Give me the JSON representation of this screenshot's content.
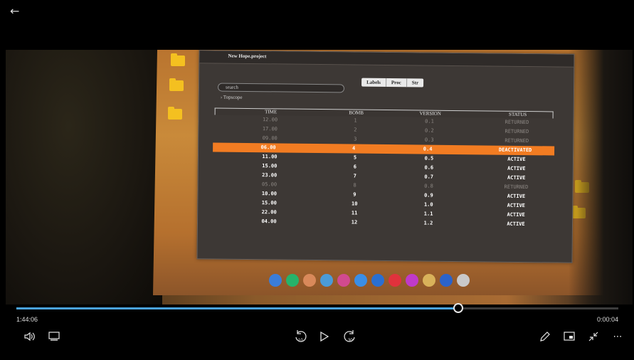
{
  "player": {
    "back_icon": "back-arrow-icon",
    "time_elapsed": "1:44:06",
    "time_remaining": "0:00:04",
    "progress_fraction": 0.734,
    "controls": {
      "volume_icon": "speaker-icon",
      "captions_icon": "captions-icon",
      "skip_back_label": "10",
      "play_icon": "play-icon",
      "skip_forward_label": "30",
      "edit_icon": "pencil-icon",
      "miniplayer_icon": "miniplayer-icon",
      "exit_fullscreen_icon": "exit-fullscreen-icon",
      "more_icon": "more-icon"
    },
    "accent_color": "#4aa3df"
  },
  "video": {
    "app_title": "New Hope.project",
    "search_placeholder": "search",
    "tree_item": "Topscope",
    "tabs": [
      "Labels",
      "Proc",
      "Str"
    ],
    "columns": [
      "TIME",
      "BOMB",
      "VERSION",
      "STATUS"
    ],
    "rows": [
      {
        "time": "12.00",
        "bomb": "1",
        "version": "0.1",
        "status": "RETURNED",
        "style": "dim"
      },
      {
        "time": "17.00",
        "bomb": "2",
        "version": "0.2",
        "status": "RETURNED",
        "style": "dim"
      },
      {
        "time": "09.00",
        "bomb": "3",
        "version": "0.3",
        "status": "RETURNED",
        "style": "dim"
      },
      {
        "time": "06.00",
        "bomb": "4",
        "version": "0.4",
        "status": "DEACTIVATED",
        "style": "selected"
      },
      {
        "time": "11.00",
        "bomb": "5",
        "version": "0.5",
        "status": "ACTIVE",
        "style": "bright"
      },
      {
        "time": "15.00",
        "bomb": "6",
        "version": "0.6",
        "status": "ACTIVE",
        "style": "bright"
      },
      {
        "time": "23.00",
        "bomb": "7",
        "version": "0.7",
        "status": "ACTIVE",
        "style": "bright"
      },
      {
        "time": "05.00",
        "bomb": "8",
        "version": "0.8",
        "status": "RETURNED",
        "style": "dim"
      },
      {
        "time": "10.00",
        "bomb": "9",
        "version": "0.9",
        "status": "ACTIVE",
        "style": "bright"
      },
      {
        "time": "15.00",
        "bomb": "10",
        "version": "1.0",
        "status": "ACTIVE",
        "style": "bright"
      },
      {
        "time": "22.00",
        "bomb": "11",
        "version": "1.1",
        "status": "ACTIVE",
        "style": "bright"
      },
      {
        "time": "04.00",
        "bomb": "12",
        "version": "1.2",
        "status": "ACTIVE",
        "style": "bright"
      }
    ],
    "selected_row_color": "#f27c22",
    "dock_colors": [
      "#3b7dd8",
      "#26b36a",
      "#d9895a",
      "#4a9bd8",
      "#d14a8f",
      "#3a8ee6",
      "#2a6fd1",
      "#e0323c",
      "#c03ac9",
      "#d9b25a",
      "#2b63c9",
      "#c9c9c9"
    ]
  }
}
